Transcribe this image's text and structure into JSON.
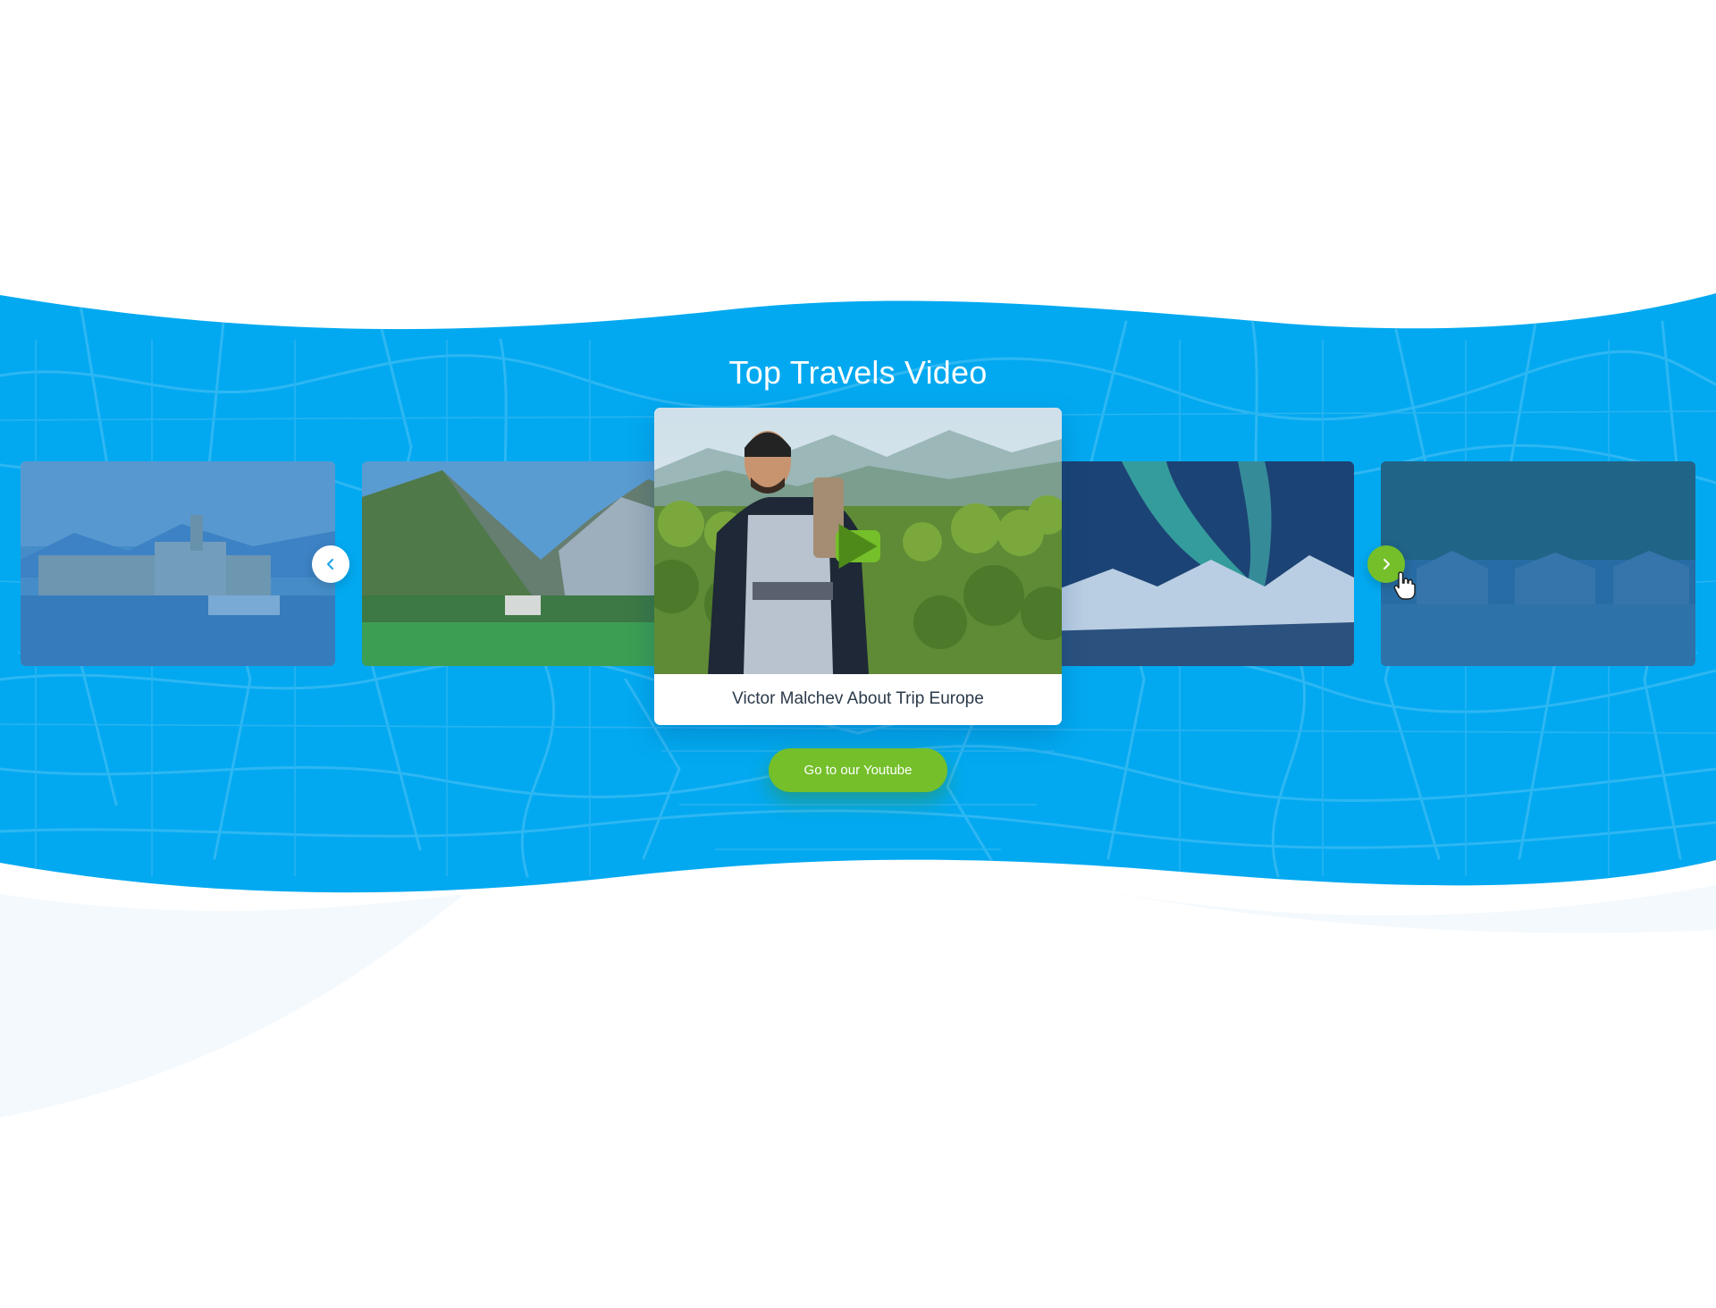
{
  "section": {
    "title": "Top Travels Video"
  },
  "carousel": {
    "featured": {
      "caption": "Victor Malchev About Trip Europe",
      "image": "backpacker-mountain-forest"
    },
    "slides": [
      {
        "image": "lakeside-town-harbor"
      },
      {
        "image": "alpine-village-meadow"
      },
      {
        "image": "aurora-snowy-mountains"
      },
      {
        "image": "lake-boathouses"
      }
    ],
    "prev_icon": "chevron-left-icon",
    "next_icon": "chevron-right-icon"
  },
  "cta": {
    "youtube_label": "Go to our Youtube"
  },
  "colors": {
    "band_blue": "#03a9f0",
    "map_lines": "#2cb8f3",
    "accent_green": "#74bf2a",
    "caption_text": "#2b3a4a"
  }
}
